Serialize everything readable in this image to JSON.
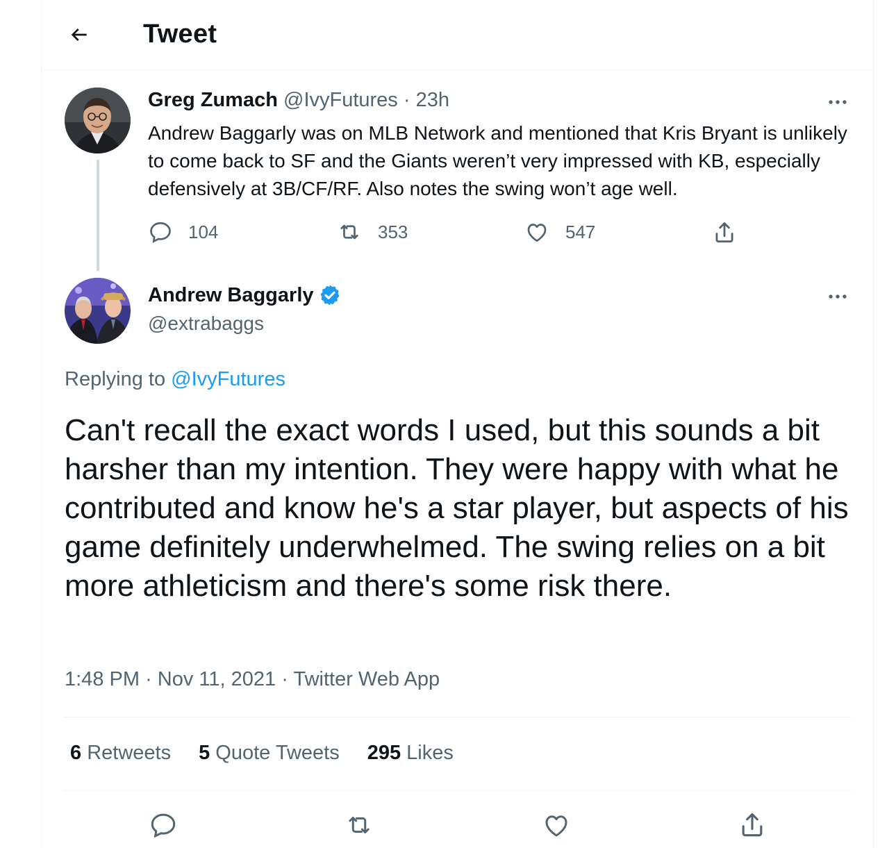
{
  "header": {
    "title": "Tweet"
  },
  "parent_tweet": {
    "display_name": "Greg Zumach",
    "handle": "@IvyFutures",
    "separator": "·",
    "time": "23h",
    "text": "Andrew Baggarly was on MLB Network and mentioned that Kris Bryant is unlikely to come back to SF and the Giants weren’t very impressed with KB, especially defensively at 3B/CF/RF. Also notes the swing won’t age well.",
    "replies": "104",
    "retweets": "353",
    "likes": "547"
  },
  "main_tweet": {
    "display_name": "Andrew Baggarly",
    "handle": "@extrabaggs",
    "replying_prefix": "Replying to",
    "replying_handle": "@IvyFutures",
    "text": "Can't recall the exact words I used, but this sounds a bit harsher than my intention. They were happy with what he contributed and know he's a star player, but aspects of his game definitely underwhelmed. The swing relies on a bit more athleticism and there's some risk there.",
    "time": "1:48 PM",
    "date": "Nov 11, 2021",
    "source": "Twitter Web App",
    "separator": "·"
  },
  "stats": {
    "retweets_count": "6",
    "retweets_label": "Retweets",
    "quotes_count": "5",
    "quotes_label": "Quote Tweets",
    "likes_count": "295",
    "likes_label": "Likes"
  },
  "colors": {
    "accent": "#1d9bf0",
    "muted": "#536471",
    "text": "#0f1419",
    "border": "#eff3f4"
  },
  "icons": [
    "back-arrow-icon",
    "more-icon",
    "reply-icon",
    "retweet-icon",
    "like-icon",
    "share-icon",
    "verified-badge-icon"
  ]
}
